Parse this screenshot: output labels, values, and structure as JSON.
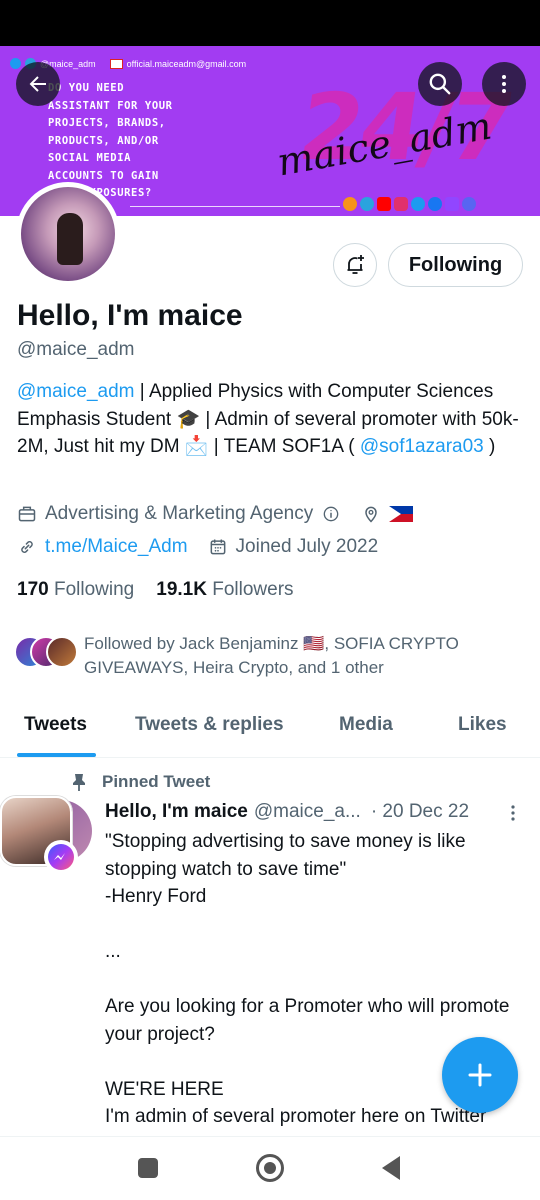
{
  "banner": {
    "social_handle": "@maice_adm",
    "email": "official.maiceadm@gmail.com",
    "tagline": "DO YOU NEED ASSISTANT FOR YOUR PROJECTS, BRANDS, PRODUCTS, AND/OR SOCIAL MEDIA ACCOUNTS TO GAIN MORE EXPOSURES?",
    "big_text": "24/7",
    "signature": "maice_adm"
  },
  "profile": {
    "display_name": "Hello, I'm maice",
    "handle": "@maice_adm",
    "follow_button": "Following",
    "bio": {
      "mention": "@maice_adm",
      "text1": " | Applied Physics with Computer Sciences Emphasis Student 🎓 | Admin of several promoter with 50k-2M, Just hit my DM 📩 | TEAM SOF1A ( ",
      "mention2": "@sof1azara03",
      "text2": " )"
    },
    "category": "Advertising & Marketing Agency",
    "website": "t.me/Maice_Adm",
    "joined": "Joined July 2022",
    "following_count": "170",
    "following_label": "Following",
    "followers_count": "19.1K",
    "followers_label": "Followers",
    "followed_by": "Followed by Jack Benjaminz 🇺🇸, SOFIA CRYPTO GIVEAWAYS, Heira Crypto, and 1 other"
  },
  "tabs": [
    "Tweets",
    "Tweets & replies",
    "Media",
    "Likes"
  ],
  "tweet": {
    "pinned_label": "Pinned Tweet",
    "name": "Hello, I'm maice",
    "handle": "@maice_a...",
    "date": "· 20 Dec 22",
    "lines": [
      "\"Stopping advertising to save money is like stopping watch to save time\"",
      "-Henry Ford",
      "",
      "...",
      "",
      "Are you looking for a Promoter who will promote your project?",
      "",
      "WE'RE HERE",
      "I'm admin of several promoter here on Twitter"
    ]
  },
  "colors": {
    "accent": "#1d9bf0",
    "banner": "#a23cf2",
    "text_primary": "#0f1419",
    "text_secondary": "#536471"
  }
}
